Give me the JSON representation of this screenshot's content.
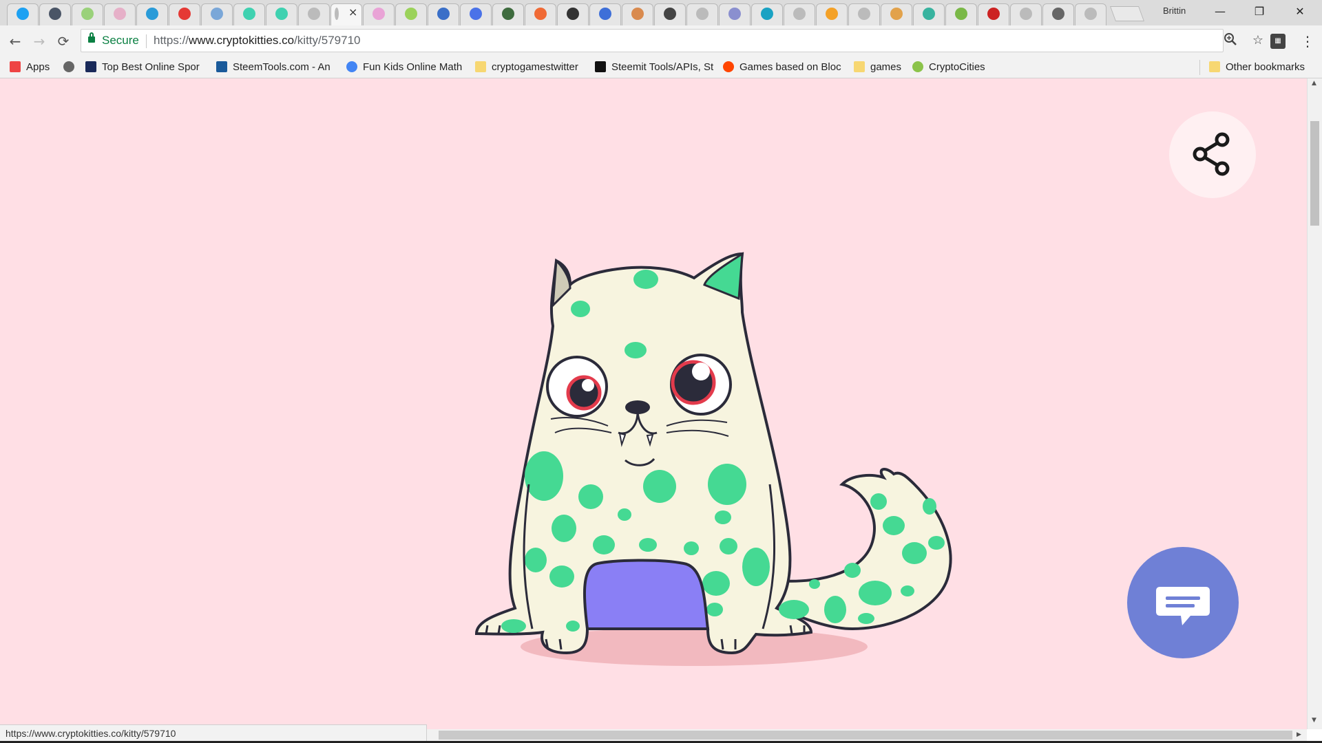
{
  "browser": {
    "profile_name": "Brittin",
    "tabs": [
      {
        "icon": "twitter-icon",
        "color": "#1da1f2"
      },
      {
        "icon": "a-icon",
        "color": "#4a5566"
      },
      {
        "icon": "a-green-icon",
        "color": "#9ad17a"
      },
      {
        "icon": "pig-icon",
        "color": "#e6b0c8"
      },
      {
        "icon": "boat-icon",
        "color": "#2a9bd8"
      },
      {
        "icon": "badge-icon",
        "color": "#e53935"
      },
      {
        "icon": "ship-icon",
        "color": "#7aa7d8"
      },
      {
        "icon": "circle-icon",
        "color": "#3fd1b0"
      },
      {
        "icon": "circle-icon",
        "color": "#3fd1b0"
      },
      {
        "icon": "page-icon",
        "color": "#bbbbbb"
      },
      {
        "icon": "active-tab-icon",
        "color": "#bbbbbb",
        "active": true
      },
      {
        "icon": "unicorn-icon",
        "color": "#e9a3d6"
      },
      {
        "icon": "house-icon",
        "color": "#9bd25a"
      },
      {
        "icon": "menu-icon",
        "color": "#3a6fc8"
      },
      {
        "icon": "ethereum-icon",
        "color": "#4a72e8"
      },
      {
        "icon": "frog-icon",
        "color": "#3e6b3e"
      },
      {
        "icon": "ball-icon",
        "color": "#f06a35"
      },
      {
        "icon": "card-icon",
        "color": "#333333"
      },
      {
        "icon": "m-icon",
        "color": "#3e6fd8"
      },
      {
        "icon": "puzzle-icon",
        "color": "#d98a4e"
      },
      {
        "icon": "soccer-icon",
        "color": "#444444"
      },
      {
        "icon": "page-icon",
        "color": "#bbbbbb"
      },
      {
        "icon": "city-icon",
        "color": "#8a8fcf"
      },
      {
        "icon": "s-icon",
        "color": "#19a2c3"
      },
      {
        "icon": "page-icon",
        "color": "#bbbbbb"
      },
      {
        "icon": "orange-icon",
        "color": "#f4a127"
      },
      {
        "icon": "page-icon",
        "color": "#bbbbbb"
      },
      {
        "icon": "pizza-icon",
        "color": "#e2a24b"
      },
      {
        "icon": "crystal-icon",
        "color": "#38b39f"
      },
      {
        "icon": "bowl-icon",
        "color": "#7ab847"
      },
      {
        "icon": "ufc-icon",
        "color": "#cc2222"
      },
      {
        "icon": "page-icon",
        "color": "#bbbbbb"
      },
      {
        "icon": "grid-icon",
        "color": "#666666"
      },
      {
        "icon": "page-icon",
        "color": "#bbbbbb"
      }
    ],
    "nav": {
      "back": "←",
      "forward": "→",
      "reload": "⟳"
    },
    "address": {
      "secure_label": "Secure",
      "scheme": "https://",
      "host": "www.cryptokitties.co",
      "path": "/kitty/579710"
    },
    "bookmarks": [
      {
        "label": "Apps",
        "icon": "apps-icon",
        "color": "#e44"
      },
      {
        "label": "",
        "icon": "history-icon",
        "color": "#666"
      },
      {
        "label": "Top Best Online Spor",
        "icon": "c-icon",
        "color": "#1a2a5a"
      },
      {
        "label": "SteemTools.com - An",
        "icon": "steem-icon",
        "color": "#1a5a9a"
      },
      {
        "label": "Fun Kids Online Math",
        "icon": "google-icon",
        "color": "#4285f4"
      },
      {
        "label": "cryptogamestwitter",
        "icon": "folder-icon",
        "color": "#f7d772"
      },
      {
        "label": "Steemit Tools/APIs, St",
        "icon": "h-icon",
        "color": "#111"
      },
      {
        "label": "Games based on Bloc",
        "icon": "reddit-icon",
        "color": "#ff4500"
      },
      {
        "label": "games",
        "icon": "folder-icon",
        "color": "#f7d772"
      },
      {
        "label": "CryptoCities",
        "icon": "cryptocities-icon",
        "color": "#8bc34a"
      }
    ],
    "other_bookmarks": "Other bookmarks",
    "status_url": "https://www.cryptokitties.co/kitty/579710"
  },
  "page": {
    "background": "#ffdfe5",
    "kitty_colors": {
      "body": "#f7f4df",
      "spots": "#45d993",
      "outline": "#2b2b3a",
      "mouth": "#8a7ff5",
      "eye_rim": "#e33b4c",
      "shadow": "#f2b9bf"
    },
    "chat_color": "#6f80d6"
  }
}
